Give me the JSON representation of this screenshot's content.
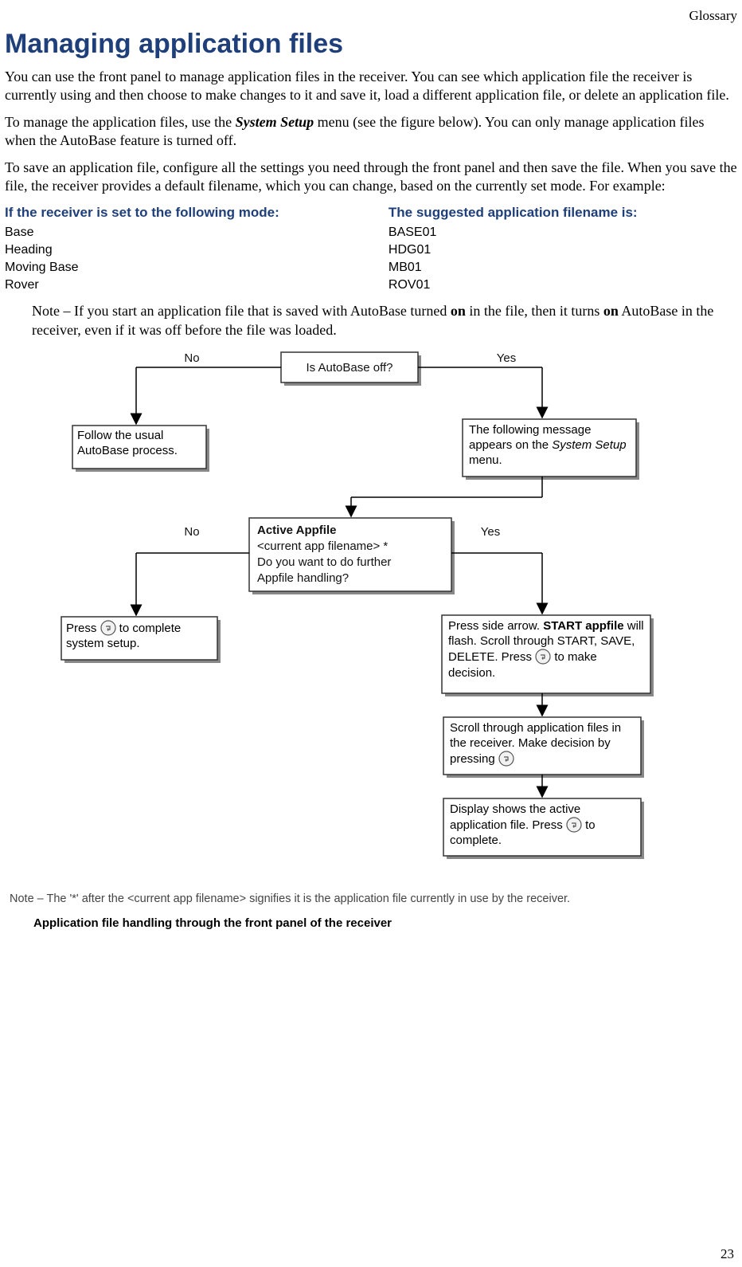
{
  "header": {
    "section": "Glossary"
  },
  "title": "Managing application files",
  "paragraphs": {
    "p1": "You can use the front panel to manage application files in the receiver. You can see which application file the receiver is currently using and then choose to make changes to it and save it, load a different application file, or delete an application file.",
    "p2a": "To manage the application files, use the ",
    "p2b": "System Setup",
    "p2c": " menu (see the figure below). You can only manage application files when the AutoBase feature is turned off.",
    "p3": "To save an application file, configure all the settings you need through the front panel and then save the file. When you save the file, the receiver provides a default filename, which you can change, based on the currently set mode. For example:"
  },
  "table": {
    "col1_header": "If the receiver is set to the following mode:",
    "col2_header": "The suggested application filename is:",
    "rows": [
      {
        "mode": "Base",
        "filename": "BASE01"
      },
      {
        "mode": "Heading",
        "filename": "HDG01"
      },
      {
        "mode": "Moving Base",
        "filename": "MB01"
      },
      {
        "mode": "Rover",
        "filename": "ROV01"
      }
    ]
  },
  "note": {
    "prefix": "Note – If you start an application file that is saved with AutoBase turned ",
    "on1": "on",
    "mid": " in the file, then it turns ",
    "on2": "on",
    "suffix": " AutoBase in the receiver, even if it was off before the file was loaded."
  },
  "flow": {
    "q1": "Is AutoBase off?",
    "no": "No",
    "yes": "Yes",
    "left1": "Follow the usual AutoBase process.",
    "right1a": "The following message appears on the ",
    "right1b": "System Setup",
    "right1c": " menu.",
    "mid_l1": "Active Appfile",
    "mid_l2": "<current app filename> *",
    "mid_l3": "Do you want to do further",
    "mid_l4": "Appfile handling?",
    "left2a": "Press ",
    "left2b": " to complete system setup.",
    "right2a": "Press side arrow. ",
    "right2b": "START appfile",
    "right2c": " will flash. Scroll through START, SAVE, DELETE. Press ",
    "right2d": " to make decision.",
    "right3a": "Scroll through application files in the receiver. Make decision by pressing ",
    "right4a": "Display shows the active application file. Press ",
    "right4b": " to complete."
  },
  "footnote": "Note – The '*' after the <current app filename> signifies it is the application file currently in use by the receiver.",
  "caption": "Application file handling through the front panel of the receiver",
  "page_number": "23"
}
